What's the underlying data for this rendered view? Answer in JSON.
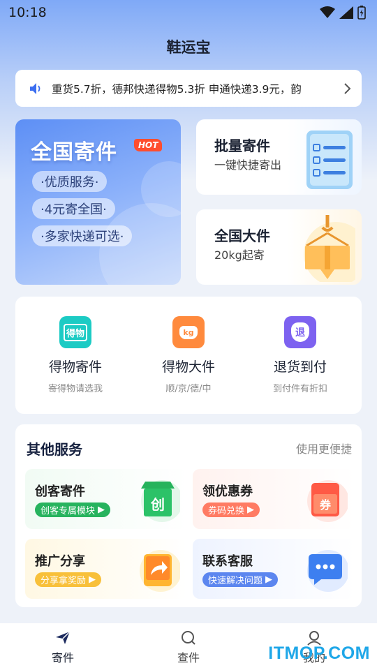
{
  "status_bar": {
    "time": "10:18"
  },
  "app_title": "鞋运宝",
  "notice": {
    "text": "重货5.7折，德邦快递得物5.3折 申通快递3.9元，韵"
  },
  "nationwide": {
    "title": "全国寄件",
    "badge": "HOT",
    "pills": [
      "·优质服务·",
      "·4元寄全国·",
      "·多家快递可选·"
    ]
  },
  "batch": {
    "title": "批量寄件",
    "subtitle": "一键快捷寄出"
  },
  "large": {
    "title": "全国大件",
    "subtitle": "20kg起寄"
  },
  "services": [
    {
      "icon_text": "得物",
      "label": "得物寄件",
      "sub": "寄得物请选我",
      "color": "#1ccbc4"
    },
    {
      "icon_text": "kg",
      "label": "得物大件",
      "sub": "顺/京/德/中",
      "color": "#ff8a3d"
    },
    {
      "icon_text": "退",
      "label": "退货到付",
      "sub": "到付件有折扣",
      "color": "#7d62f0"
    }
  ],
  "other_services": {
    "title": "其他服务",
    "more": "使用更便捷",
    "tiles": [
      {
        "title": "创客寄件",
        "button": "创客专属模块",
        "icon_text": "创",
        "btn_color": "#27b35e",
        "bg": "#eefaf1"
      },
      {
        "title": "领优惠券",
        "button": "券码兑换",
        "icon_text": "券",
        "btn_color": "#ff7b63",
        "bg": "#fff1ee"
      },
      {
        "title": "推广分享",
        "button": "分享拿奖励",
        "icon_text": "",
        "btn_color": "#f8c03a",
        "bg": "#fff8e6"
      },
      {
        "title": "联系客服",
        "button": "快速解决问题",
        "icon_text": "",
        "btn_color": "#5c86ef",
        "bg": "#eef3ff"
      }
    ]
  },
  "tabs": [
    {
      "label": "寄件",
      "icon": "send-icon"
    },
    {
      "label": "查件",
      "icon": "search-icon"
    },
    {
      "label": "我的",
      "icon": "user-icon"
    }
  ],
  "watermark": "ITMOP.COM"
}
